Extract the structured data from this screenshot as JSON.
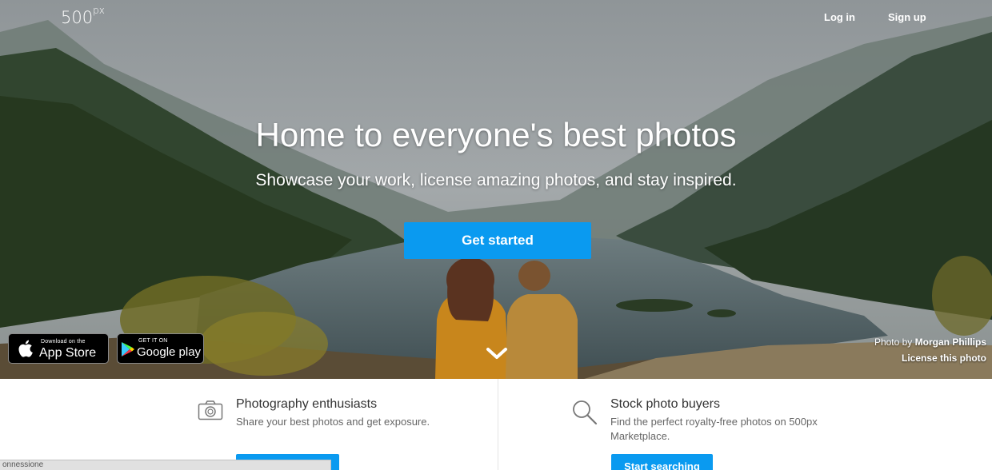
{
  "header": {
    "logo_text": "500",
    "logo_sup": "px",
    "login_label": "Log in",
    "signup_label": "Sign up"
  },
  "hero": {
    "title": "Home to everyone's best photos",
    "subtitle": "Showcase your work, license amazing photos, and stay inspired.",
    "cta_label": "Get started",
    "credit_prefix": "Photo by",
    "credit_author": "Morgan Phillips",
    "license_label": "License this photo"
  },
  "store_badges": {
    "apple_small": "Download on the",
    "apple_big": "App Store",
    "google_small": "GET IT ON",
    "google_big": "Google play"
  },
  "features": [
    {
      "icon": "camera-icon",
      "title": "Photography enthusiasts",
      "description": "Share your best photos and get exposure.",
      "button_label": ""
    },
    {
      "icon": "magnifier-icon",
      "title": "Stock photo buyers",
      "description": "Find the perfect royalty-free photos on 500px Marketplace.",
      "button_label": "Start searching"
    }
  ],
  "status_bar": {
    "text": "onnessione"
  },
  "colors": {
    "accent": "#0a9af0",
    "text_dark": "#333333",
    "text_muted": "#666666"
  }
}
